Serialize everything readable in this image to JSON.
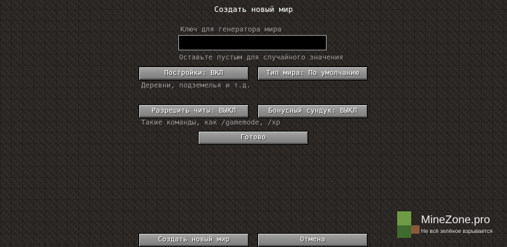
{
  "screen": {
    "title": "Создать новый мир"
  },
  "seed": {
    "label": "Ключ для генератора мира",
    "value": "",
    "hint": "Оставьте пустым для случайного значения"
  },
  "options": {
    "structures_button": "Постройки: ВКЛ",
    "structures_hint": "Деревни, подземелья и т.д.",
    "world_type_button": "Тип мира: По умолчанию",
    "allow_cheats_button": "Разрешить читы: ВЫКЛ",
    "cheats_hint": "Такие команды, как /gamemode, /xp",
    "bonus_chest_button": "Бонусный сундук: ВЫКЛ",
    "done_button": "Готово"
  },
  "footer": {
    "create_button": "Создать новый мир",
    "cancel_button": "Отмена"
  },
  "watermark": {
    "site": "MineZone.pro",
    "tagline": "Не всё зелёное взрывается",
    "colors": {
      "green": "#6e9c45",
      "dark_green": "#3f6b2e",
      "brown": "#8a5a3c"
    }
  }
}
